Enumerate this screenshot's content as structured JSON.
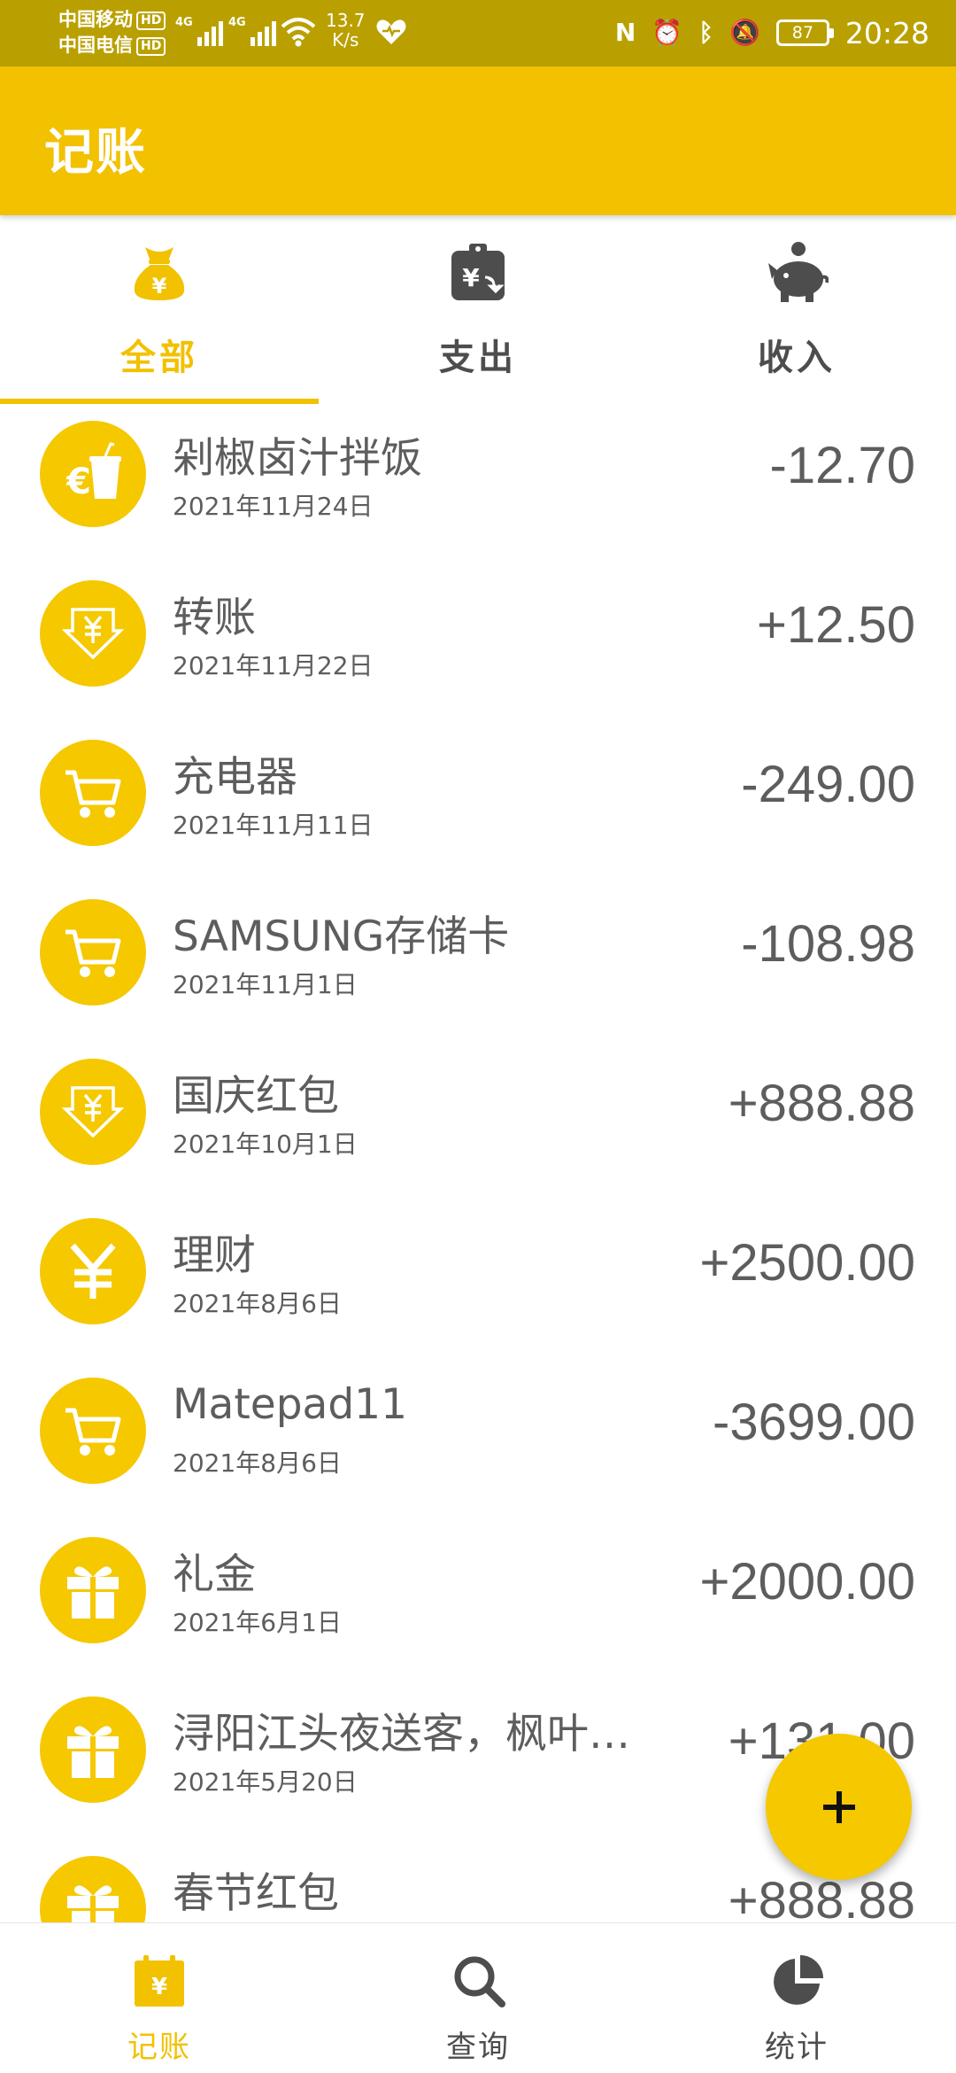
{
  "status_bar": {
    "carrier1": "中国移动",
    "carrier2": "中国电信",
    "hd": "HD",
    "net": "4G",
    "speed_value": "13.7",
    "speed_unit": "K/s",
    "battery": "87",
    "time": "20:28"
  },
  "app": {
    "title": "记账",
    "accent_color": "#f2c100"
  },
  "tabs": [
    {
      "label": "全部",
      "icon": "money-bag-icon",
      "active": true
    },
    {
      "label": "支出",
      "icon": "wallet-expense-icon",
      "active": false
    },
    {
      "label": "收入",
      "icon": "piggy-bank-icon",
      "active": false
    }
  ],
  "records": [
    {
      "title": "剁椒卤汁拌饭",
      "date": "2021年11月24日",
      "amount": "-12.70",
      "icon": "food-drink-icon"
    },
    {
      "title": "转账",
      "date": "2021年11月22日",
      "amount": "+12.50",
      "icon": "transfer-in-icon"
    },
    {
      "title": "充电器",
      "date": "2021年11月11日",
      "amount": "-249.00",
      "icon": "shopping-cart-icon"
    },
    {
      "title": "SAMSUNG存储卡",
      "date": "2021年11月1日",
      "amount": "-108.98",
      "icon": "shopping-cart-icon"
    },
    {
      "title": "国庆红包",
      "date": "2021年10月1日",
      "amount": "+888.88",
      "icon": "transfer-in-icon"
    },
    {
      "title": "理财",
      "date": "2021年8月6日",
      "amount": "+2500.00",
      "icon": "yen-icon"
    },
    {
      "title": "Matepad11",
      "date": "2021年8月6日",
      "amount": "-3699.00",
      "icon": "shopping-cart-icon"
    },
    {
      "title": "礼金",
      "date": "2021年6月1日",
      "amount": "+2000.00",
      "icon": "gift-icon"
    },
    {
      "title": "浔阳江头夜送客，枫叶…",
      "date": "2021年5月20日",
      "amount": "+131.00",
      "icon": "gift-icon"
    },
    {
      "title": "春节红包",
      "date": "",
      "amount": "+888.88",
      "icon": "gift-icon"
    }
  ],
  "fab": {
    "icon": "plus-icon"
  },
  "bottom_nav": [
    {
      "label": "记账",
      "icon": "ledger-icon",
      "active": true
    },
    {
      "label": "查询",
      "icon": "search-icon",
      "active": false
    },
    {
      "label": "统计",
      "icon": "pie-chart-icon",
      "active": false
    }
  ]
}
